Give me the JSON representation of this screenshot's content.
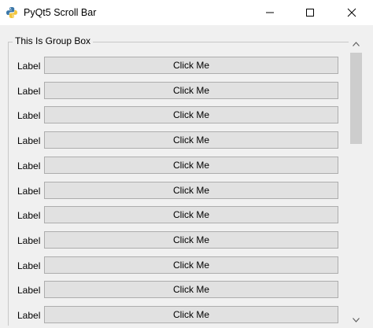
{
  "window": {
    "title": "PyQt5 Scroll Bar",
    "app_icon": "python-logo-icon",
    "controls": [
      "minimize-icon",
      "maximize-icon",
      "close-icon"
    ]
  },
  "group_box": {
    "title": "This Is Group Box"
  },
  "rows": [
    {
      "label": "Label",
      "button": "Click Me"
    },
    {
      "label": "Label",
      "button": "Click Me"
    },
    {
      "label": "Label",
      "button": "Click Me"
    },
    {
      "label": "Label",
      "button": "Click Me"
    },
    {
      "label": "Label",
      "button": "Click Me"
    },
    {
      "label": "Label",
      "button": "Click Me"
    },
    {
      "label": "Label",
      "button": "Click Me"
    },
    {
      "label": "Label",
      "button": "Click Me"
    },
    {
      "label": "Label",
      "button": "Click Me"
    },
    {
      "label": "Label",
      "button": "Click Me"
    },
    {
      "label": "Label",
      "button": "Click Me"
    }
  ],
  "scrollbar": {
    "orientation": "vertical",
    "position": 0
  }
}
